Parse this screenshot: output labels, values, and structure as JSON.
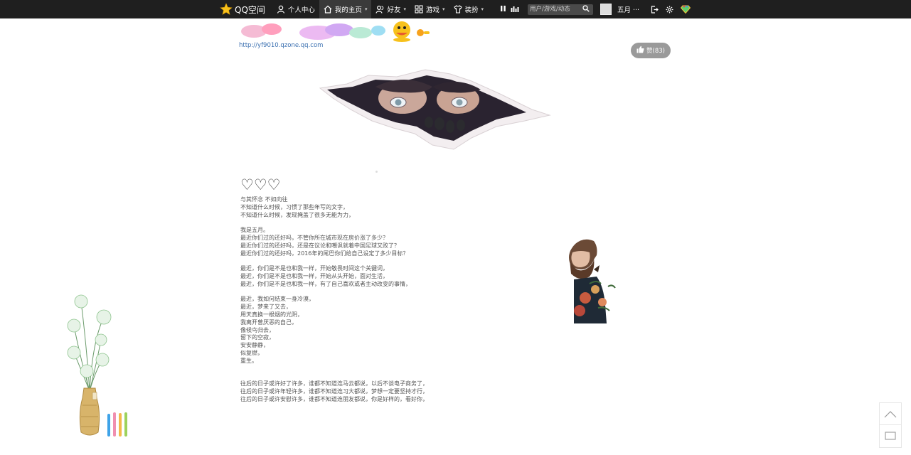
{
  "topbar": {
    "logo_text": "QQ空间",
    "nav": [
      {
        "label": "个人中心",
        "icon": "person-icon"
      },
      {
        "label": "我的主页",
        "icon": "home-icon",
        "active": true,
        "caret": "▾"
      },
      {
        "label": "好友",
        "icon": "friends-icon",
        "caret": "▾"
      },
      {
        "label": "游戏",
        "icon": "grid-icon",
        "caret": "▾"
      },
      {
        "label": "装扮",
        "icon": "shirt-icon",
        "caret": "▾"
      }
    ],
    "search_placeholder": "用户/游戏/动态",
    "username": "五月 ···"
  },
  "header": {
    "zone_url": "http://yf9010.qzone.qq.com",
    "like_label": "赞(83)"
  },
  "post": {
    "hearts": "♡♡♡",
    "paragraphs": [
      [
        "与其怀念 不如向往",
        "不知道什么时候，习惯了那些年写的文字，",
        "不知道什么时候，发现掩盖了很多无能为力，"
      ],
      [
        "我是五月。",
        "最近你们过的还好吗，不管你所在城市现在房价涨了多少？",
        "最近你们过的还好吗，还是在议论和嘲讽就着中国足球又败了？",
        "最近你们过的还好吗，2016年的尾巴你们给自己设定了多少目标？"
      ],
      [
        "最近，你们是不是也和我一样，开始敬畏时间这个关键词，",
        "最近，你们是不是也和我一样，开始从头开始，面对生活，",
        "最近，你们是不是也和我一样，有了自己喜欢或者主动改变的事情，"
      ],
      [
        "最近，我如何结束一身冷漠，",
        "最近，梦来了又去，",
        "用天真换一根烟的光阴，",
        "我离开曾厌恶的自己，",
        "像候鸟归去，",
        "留下的空寂，",
        "安安静静，",
        "似复燃，",
        "重生。"
      ],
      [
        "往后的日子或许好了许多，谁都不知道连马云都说，以后不谈电子商务了，",
        "往后的日子或许年轻许多，谁都不知道连习大都说，梦想一定要坚持才行，",
        "往后的日子或许安慰许多，谁都不知道连朋友都说，你是好样的，看好你，"
      ]
    ]
  },
  "colors": {
    "topbar_bg": "#1f1f1f",
    "link": "#3a6fb0",
    "like_bg": "#9a9a9a",
    "logo_star": "#f7c11c"
  }
}
